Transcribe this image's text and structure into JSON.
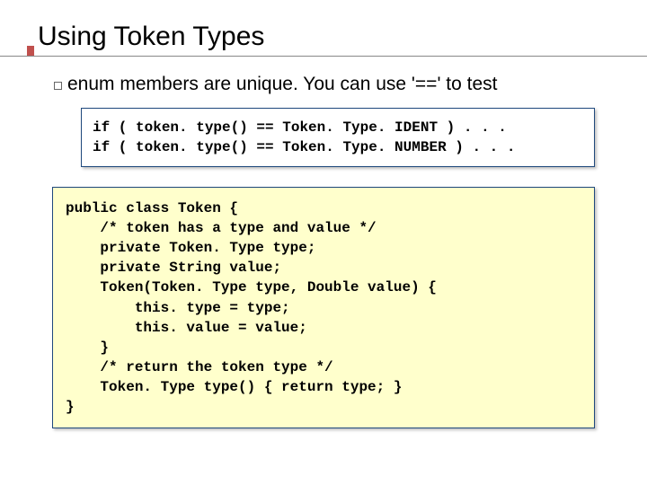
{
  "title": "Using Token Types",
  "bullet": "enum members are unique. You can use '==' to test",
  "code1": "if ( token. type() == Token. Type. IDENT ) . . .\nif ( token. type() == Token. Type. NUMBER ) . . .",
  "code2": "public class Token {\n    /* token has a type and value */\n    private Token. Type type;\n    private String value;\n    Token(Token. Type type, Double value) {\n        this. type = type;\n        this. value = value;\n    }\n    /* return the token type */\n    Token. Type type() { return type; }\n}"
}
